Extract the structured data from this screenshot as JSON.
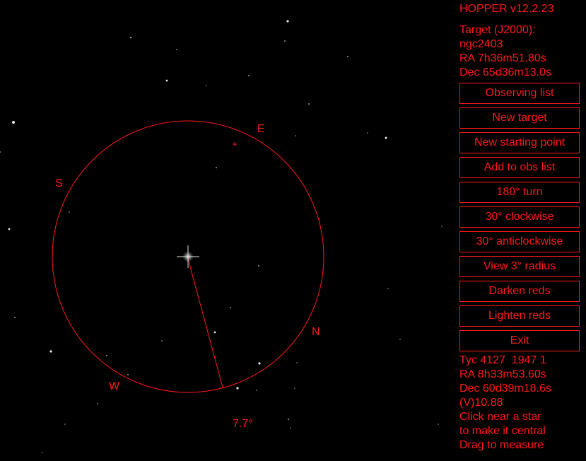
{
  "app": {
    "title": "HOPPER v12.2.23"
  },
  "target": {
    "label": "Target (J2000):",
    "name": "ngc2403",
    "ra": "RA 7h36m51.80s",
    "dec": "Dec 65d36m13.0s"
  },
  "buttons": [
    {
      "label": "Observing list"
    },
    {
      "label": "New target"
    },
    {
      "label": "New starting point"
    },
    {
      "label": "Add to obs list"
    },
    {
      "label": "180° turn"
    },
    {
      "label": "30° clockwise"
    },
    {
      "label": "30° anticlockwise"
    },
    {
      "label": "View 3° radius"
    },
    {
      "label": "Darken reds"
    },
    {
      "label": "Lighten reds"
    },
    {
      "label": "Exit"
    }
  ],
  "selected_star": {
    "id": "Tyc 4127  1947 1",
    "ra": "RA 8h33m53.60s",
    "dec": "Dec 60d39m18.6s",
    "mag": "(V)10.88"
  },
  "help": {
    "line1": "Click near a star",
    "line2": "to make it central",
    "line3": "Drag to measure"
  },
  "compass": {
    "e": "E",
    "s": "S",
    "w": "W",
    "n": "N"
  },
  "measurement": {
    "label": "7.7°"
  },
  "colors": {
    "accent": "#ff1a1a",
    "background": "#000000"
  }
}
